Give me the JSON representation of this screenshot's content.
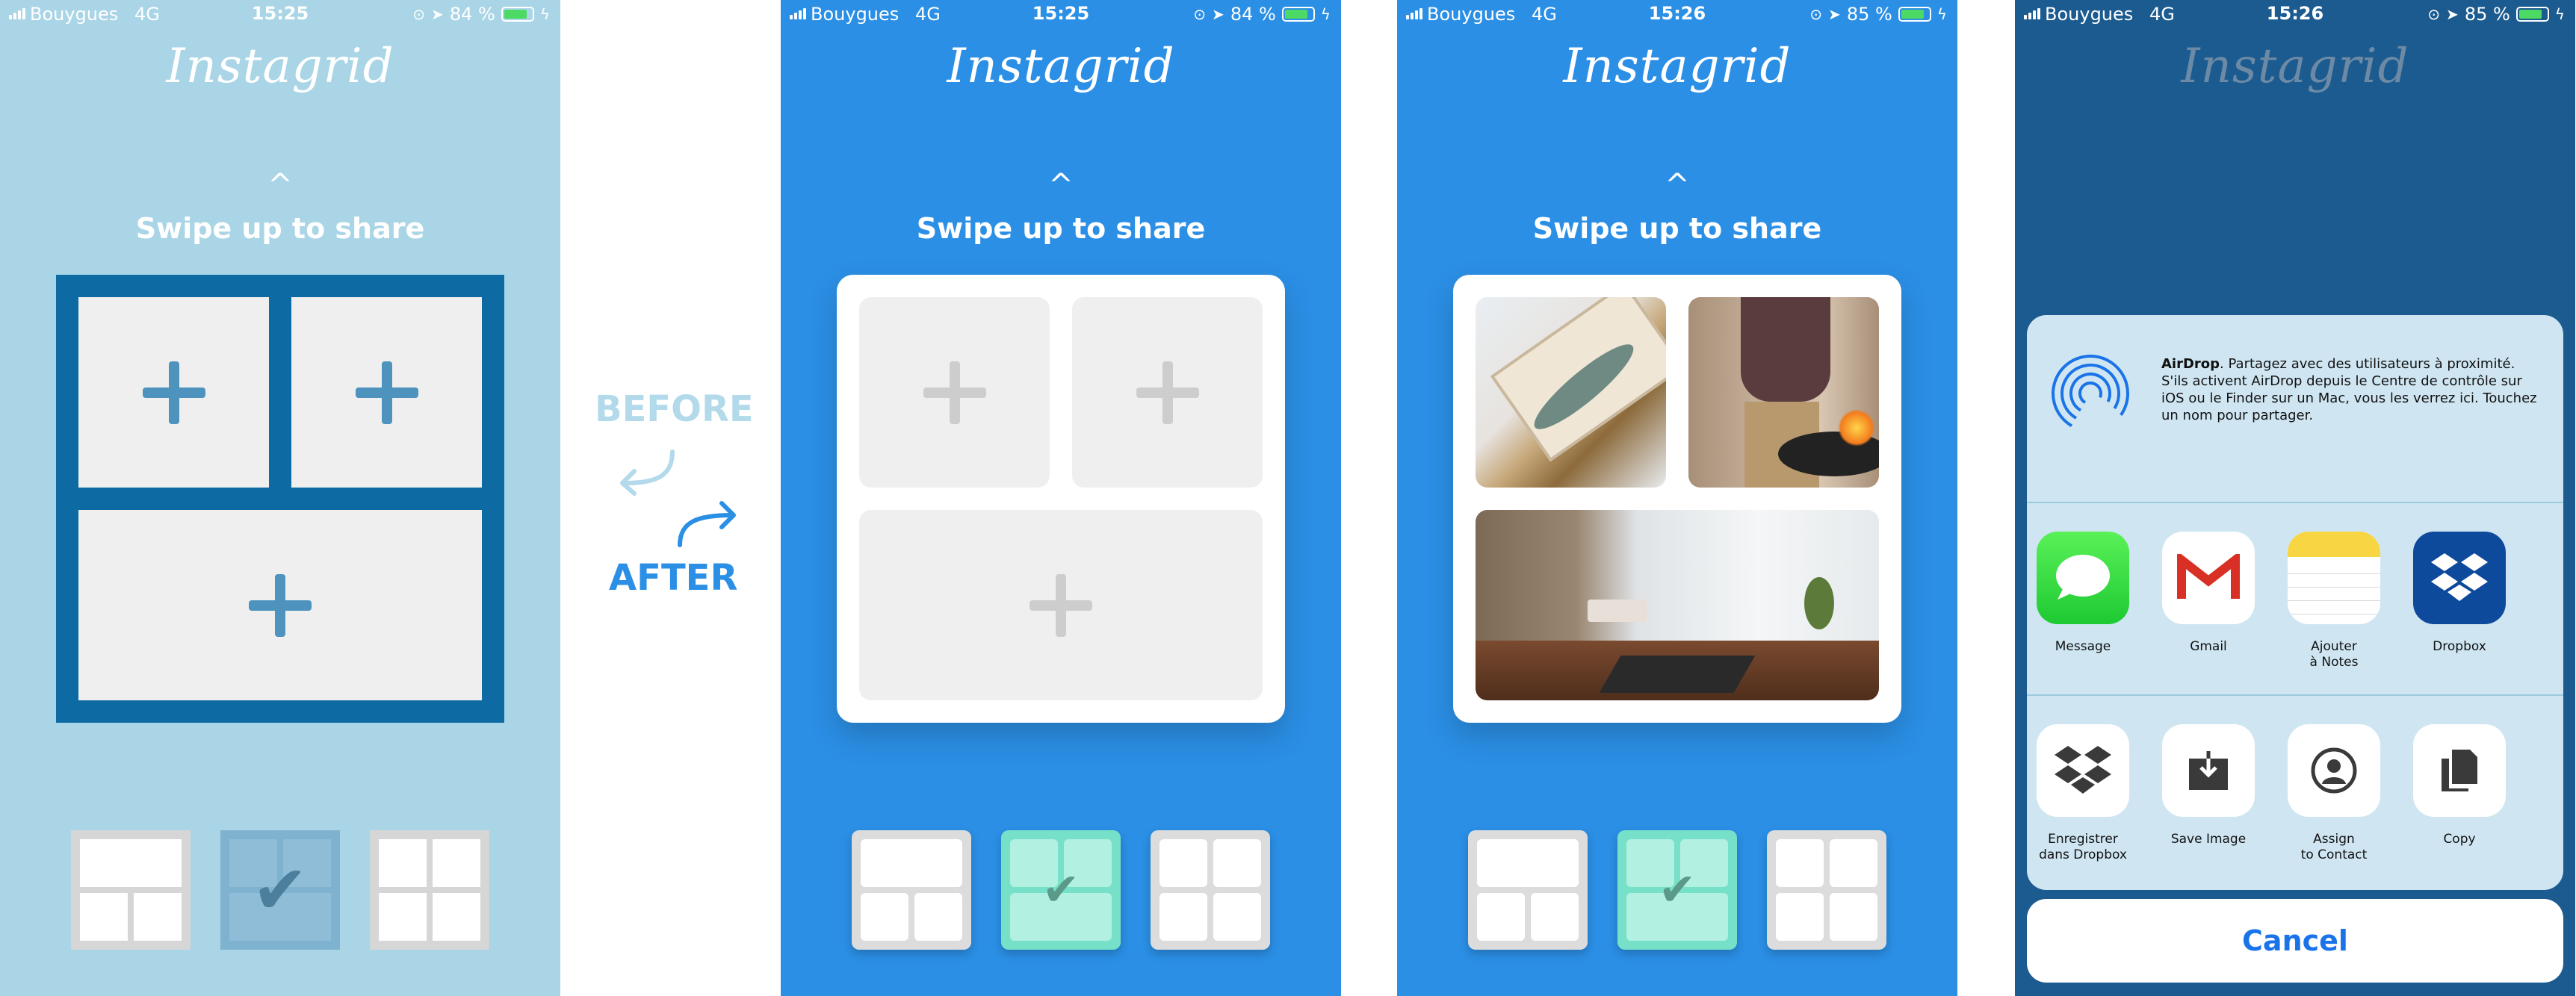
{
  "status": [
    {
      "carrier": "Bouygues",
      "network": "4G",
      "time": "15:25",
      "battery": "84 %"
    },
    {
      "carrier": "Bouygues",
      "network": "4G",
      "time": "15:25",
      "battery": "84 %"
    },
    {
      "carrier": "Bouygues",
      "network": "4G",
      "time": "15:26",
      "battery": "85 %"
    },
    {
      "carrier": "Bouygues",
      "network": "4G",
      "time": "15:26",
      "battery": "85 %"
    }
  ],
  "app": {
    "logo": "Instagrid",
    "chevron": "^",
    "swipe": "Swipe up to share"
  },
  "labels": {
    "before": "BEFORE",
    "after": "AFTER"
  },
  "colors": {
    "before_bg": "#a9d5e6",
    "after_bg": "#2b8fe5",
    "share_bg": "#1b5b8f",
    "selected": "#77e0c8"
  },
  "icons": {
    "plus": "plus-icon",
    "check": "checkmark-icon"
  },
  "share": {
    "airdrop_title": "AirDrop",
    "airdrop_text": ". Partagez avec des utilisateurs à proximité. S'ils activent AirDrop depuis le Centre de contrôle sur iOS ou le Finder sur un Mac, vous les verrez ici. Touchez un nom pour partager.",
    "apps": [
      {
        "label": "Message",
        "icon": "messages-icon"
      },
      {
        "label": "Gmail",
        "icon": "gmail-icon"
      },
      {
        "label": "Ajouter\nà Notes",
        "icon": "notes-icon"
      },
      {
        "label": "Dropbox",
        "icon": "dropbox-icon"
      }
    ],
    "actions": [
      {
        "label": "Enregistrer\ndans Dropbox",
        "icon": "dropbox-save-icon"
      },
      {
        "label": "Save Image",
        "icon": "save-image-icon"
      },
      {
        "label": "Assign\nto Contact",
        "icon": "contact-icon"
      },
      {
        "label": "Copy",
        "icon": "copy-icon"
      }
    ],
    "cancel": "Cancel"
  }
}
